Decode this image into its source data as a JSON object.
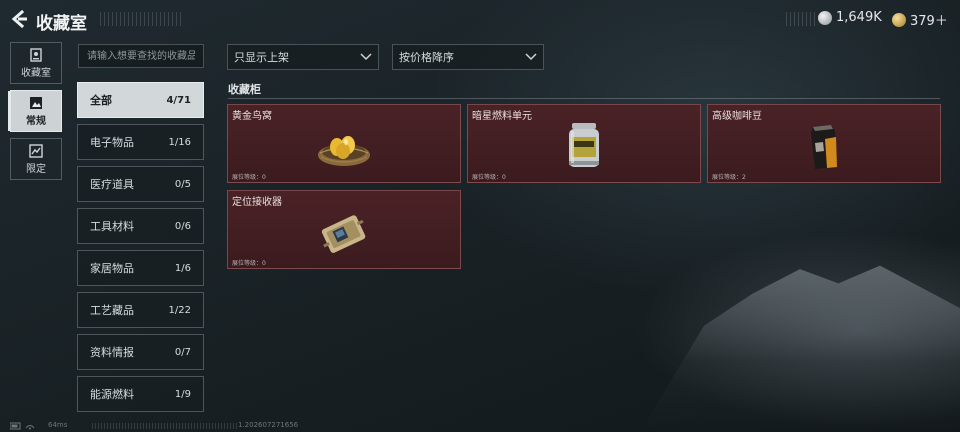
{
  "header": {
    "title": "收藏室",
    "currencies": [
      {
        "name": "silver",
        "value": "1,649K"
      },
      {
        "name": "gold",
        "value": "379＋"
      }
    ]
  },
  "nav": [
    {
      "label": "收藏室",
      "icon": "collection-room-icon",
      "active": false
    },
    {
      "label": "常规",
      "icon": "regular-icon",
      "active": true
    },
    {
      "label": "限定",
      "icon": "limited-icon",
      "active": false
    }
  ],
  "search": {
    "placeholder": "请输入想要查找的收藏品",
    "value": ""
  },
  "categories": [
    {
      "name": "全部",
      "count": "4/71",
      "active": true
    },
    {
      "name": "电子物品",
      "count": "1/16"
    },
    {
      "name": "医疗道具",
      "count": "0/5"
    },
    {
      "name": "工具材料",
      "count": "0/6"
    },
    {
      "name": "家居物品",
      "count": "1/6"
    },
    {
      "name": "工艺藏品",
      "count": "1/22"
    },
    {
      "name": "资料情报",
      "count": "0/7"
    },
    {
      "name": "能源燃料",
      "count": "1/9"
    }
  ],
  "filters": {
    "shelf": "只显示上架",
    "sort": "按价格降序"
  },
  "section": {
    "title": "收藏柜"
  },
  "slot_label": "展位等级：",
  "items": [
    {
      "name": "黄金鸟窝",
      "level": "0",
      "icon": "golden-nest-icon"
    },
    {
      "name": "暗星燃料单元",
      "level": "0",
      "icon": "fuel-canister-icon"
    },
    {
      "name": "高级咖啡豆",
      "level": "2",
      "icon": "coffee-bag-icon"
    },
    {
      "name": "定位接收器",
      "level": "0",
      "icon": "receiver-device-icon"
    }
  ],
  "status": {
    "ping": "64ms",
    "version": "1.202607271656"
  },
  "colors": {
    "card_bg": "#4a2226",
    "active_bg": "#dee2e5",
    "background": "#1a2327"
  }
}
